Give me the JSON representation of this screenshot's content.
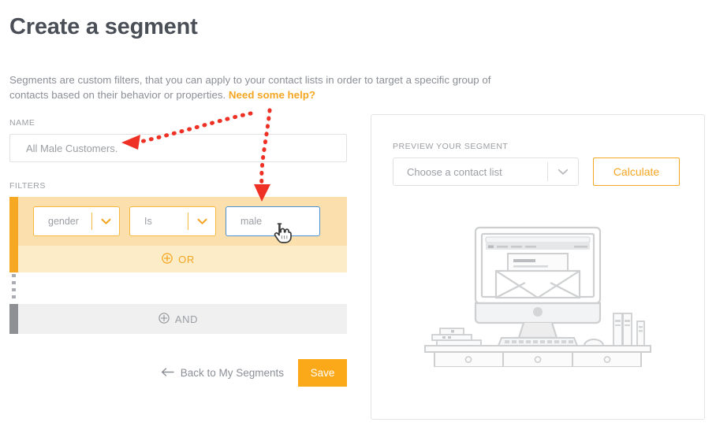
{
  "page": {
    "title": "Create a segment",
    "intro_text": "Segments are custom filters, that you can apply to your contact lists in order to target a specific group of contacts based on their behavior or properties. ",
    "intro_link": "Need some help?"
  },
  "form": {
    "name_label": "NAME",
    "name_value": "All Male Customers.",
    "name_placeholder": "All Male Customers.",
    "filters_label": "FILTERS"
  },
  "filter_row": {
    "field": "gender",
    "operator": "Is",
    "value": "male",
    "value_placeholder": "male",
    "field_icon": "chevron-down-icon",
    "operator_icon": "chevron-down-icon"
  },
  "group_buttons": {
    "or_label": "OR",
    "and_label": "AND",
    "plus_icon": "circle-plus-icon"
  },
  "actions": {
    "back_label": "Back to My Segments",
    "back_icon": "arrow-left-icon",
    "save_label": "Save"
  },
  "preview": {
    "label": "PREVIEW YOUR SEGMENT",
    "contact_list_value": "Choose a contact list",
    "contact_list_icon": "chevron-down-icon",
    "calculate_label": "Calculate",
    "illustration_name": "desk-monitor-email-illustration"
  },
  "colors": {
    "accent_orange": "#f5a623",
    "accent_bar": "#f7a823",
    "save_orange": "#fba919",
    "filter_row_bg": "#fbe0ad",
    "or_bg": "#fdecc8",
    "and_bg": "#f0f0f0",
    "and_accent": "#8e9094",
    "focus_blue": "#4a90d9",
    "annotation_red": "#ee3124",
    "text_gray": "#9b9ea3",
    "title_gray": "#4a4f57"
  },
  "annotations": {
    "arrow_to_name": "red-dotted-arrow-pointing-to-name-field",
    "arrow_to_value": "red-dotted-arrow-pointing-to-value-field"
  }
}
